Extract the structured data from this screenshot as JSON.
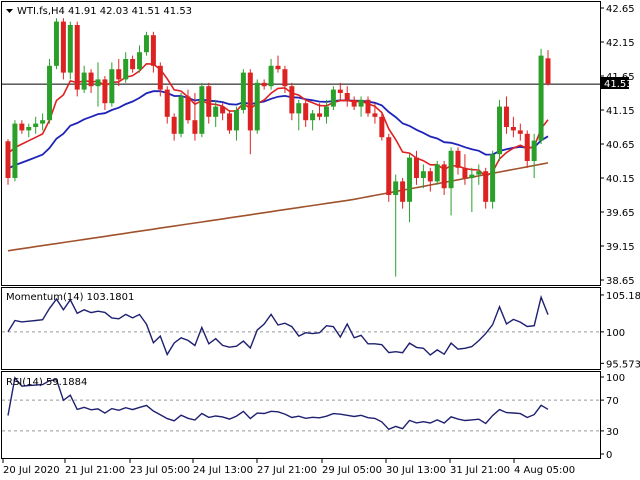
{
  "chart_data": [
    {
      "type": "candlestick",
      "title": "WTI.fs,H4",
      "ohlc_header": "41.91 42.03 41.51 41.53",
      "current_price_label": "41.53",
      "ylim": [
        38.5,
        42.7
      ],
      "y_ticks": [
        "42.65",
        "42.15",
        "41.65",
        "41.15",
        "40.65",
        "40.15",
        "39.65",
        "39.15",
        "38.65"
      ],
      "colors": {
        "up": "#2aa02a",
        "down": "#dd2222",
        "ema_fast": "#dd2222",
        "ema_mid": "#1f24b8",
        "ema_slow": "#a0522d"
      },
      "candles": [
        [
          40.69,
          40.72,
          40.05,
          40.15
        ],
        [
          40.15,
          41.0,
          40.1,
          40.95
        ],
        [
          40.95,
          41.0,
          40.8,
          40.85
        ],
        [
          40.85,
          40.95,
          40.75,
          40.9
        ],
        [
          40.9,
          41.05,
          40.8,
          40.95
        ],
        [
          40.95,
          41.1,
          40.85,
          41.0
        ],
        [
          41.0,
          41.9,
          40.95,
          41.8
        ],
        [
          41.8,
          42.5,
          41.75,
          42.45
        ],
        [
          42.45,
          42.5,
          41.6,
          41.7
        ],
        [
          41.7,
          42.45,
          41.6,
          42.4
        ],
        [
          42.4,
          42.45,
          41.35,
          41.45
        ],
        [
          41.45,
          41.8,
          41.4,
          41.7
        ],
        [
          41.7,
          41.75,
          41.4,
          41.5
        ],
        [
          41.5,
          41.85,
          41.2,
          41.6
        ],
        [
          41.6,
          41.65,
          41.15,
          41.25
        ],
        [
          41.25,
          41.85,
          41.2,
          41.75
        ],
        [
          41.75,
          41.9,
          41.5,
          41.6
        ],
        [
          41.6,
          42.0,
          41.55,
          41.9
        ],
        [
          41.9,
          41.95,
          41.7,
          41.75
        ],
        [
          41.75,
          42.1,
          41.7,
          42.0
        ],
        [
          42.0,
          42.3,
          41.95,
          42.25
        ],
        [
          42.25,
          42.3,
          41.7,
          41.8
        ],
        [
          41.8,
          41.85,
          41.35,
          41.45
        ],
        [
          41.45,
          41.5,
          40.95,
          41.05
        ],
        [
          41.05,
          41.1,
          40.7,
          40.8
        ],
        [
          40.8,
          41.4,
          40.75,
          41.35
        ],
        [
          41.35,
          41.45,
          40.95,
          41.0
        ],
        [
          41.0,
          41.4,
          40.7,
          40.8
        ],
        [
          40.8,
          41.55,
          40.75,
          41.5
        ],
        [
          41.5,
          41.55,
          40.95,
          41.05
        ],
        [
          41.05,
          41.3,
          40.9,
          41.2
        ],
        [
          41.2,
          41.25,
          41.0,
          41.1
        ],
        [
          41.1,
          41.15,
          40.8,
          40.85
        ],
        [
          40.85,
          41.2,
          40.7,
          41.15
        ],
        [
          41.15,
          41.75,
          41.1,
          41.7
        ],
        [
          41.7,
          41.75,
          40.5,
          40.85
        ],
        [
          40.85,
          41.6,
          40.8,
          41.55
        ],
        [
          41.55,
          41.6,
          41.45,
          41.5
        ],
        [
          41.5,
          41.9,
          41.45,
          41.8
        ],
        [
          41.8,
          41.95,
          41.7,
          41.75
        ],
        [
          41.75,
          41.8,
          41.4,
          41.5
        ],
        [
          41.5,
          41.55,
          41.0,
          41.1
        ],
        [
          41.1,
          41.3,
          40.85,
          41.25
        ],
        [
          41.25,
          41.3,
          40.9,
          41.0
        ],
        [
          41.0,
          41.15,
          40.85,
          41.1
        ],
        [
          41.1,
          41.25,
          41.0,
          41.05
        ],
        [
          41.05,
          41.3,
          40.95,
          41.2
        ],
        [
          41.2,
          41.5,
          41.15,
          41.45
        ],
        [
          41.45,
          41.55,
          41.3,
          41.4
        ],
        [
          41.4,
          41.5,
          41.2,
          41.3
        ],
        [
          41.3,
          41.35,
          41.15,
          41.2
        ],
        [
          41.2,
          41.35,
          41.05,
          41.3
        ],
        [
          41.3,
          41.35,
          41.05,
          41.1
        ],
        [
          41.1,
          41.25,
          40.95,
          41.05
        ],
        [
          41.05,
          41.1,
          40.7,
          40.75
        ],
        [
          40.75,
          40.8,
          39.8,
          39.9
        ],
        [
          39.9,
          40.2,
          38.7,
          40.1
        ],
        [
          40.1,
          40.15,
          39.7,
          39.8
        ],
        [
          39.8,
          40.5,
          39.5,
          40.45
        ],
        [
          40.45,
          40.55,
          40.05,
          40.15
        ],
        [
          40.15,
          40.35,
          40.0,
          40.25
        ],
        [
          40.25,
          40.3,
          39.95,
          40.1
        ],
        [
          40.1,
          40.4,
          40.05,
          40.35
        ],
        [
          40.35,
          40.4,
          39.9,
          40.0
        ],
        [
          40.0,
          40.6,
          39.6,
          40.55
        ],
        [
          40.55,
          40.6,
          40.2,
          40.3
        ],
        [
          40.3,
          40.5,
          40.05,
          40.15
        ],
        [
          40.15,
          40.3,
          39.65,
          40.2
        ],
        [
          40.2,
          40.35,
          40.05,
          40.25
        ],
        [
          40.25,
          40.3,
          39.7,
          39.8
        ],
        [
          39.8,
          40.55,
          39.7,
          40.5
        ],
        [
          40.5,
          41.3,
          40.4,
          41.2
        ],
        [
          41.2,
          41.35,
          40.8,
          40.9
        ],
        [
          40.9,
          41.05,
          40.75,
          40.85
        ],
        [
          40.85,
          40.95,
          40.7,
          40.8
        ],
        [
          40.8,
          40.85,
          40.3,
          40.4
        ],
        [
          40.4,
          40.8,
          40.15,
          40.7
        ],
        [
          40.7,
          42.05,
          40.65,
          41.95
        ],
        [
          41.91,
          42.03,
          41.51,
          41.53
        ]
      ]
    },
    {
      "type": "line",
      "title": "Momentum(14) 103.1801",
      "ylim": [
        95.2,
        105.6
      ],
      "y_ticks": [
        "105.1857",
        "100",
        "95.5737"
      ],
      "reference_level": 100,
      "color": "#1f2070"
    },
    {
      "type": "line",
      "title": "RSI(14) 59.1884",
      "ylim": [
        0,
        100
      ],
      "y_ticks": [
        "100",
        "70",
        "30",
        "0"
      ],
      "levels": [
        70,
        30
      ],
      "color": "#1f2070"
    }
  ],
  "x_axis": {
    "labels": [
      "20 Jul 2020",
      "21 Jul 21:00",
      "23 Jul 05:00",
      "24 Jul 13:00",
      "27 Jul 21:00",
      "29 Jul 05:00",
      "30 Jul 13:00",
      "31 Jul 21:00",
      "4 Aug 05:00"
    ]
  }
}
